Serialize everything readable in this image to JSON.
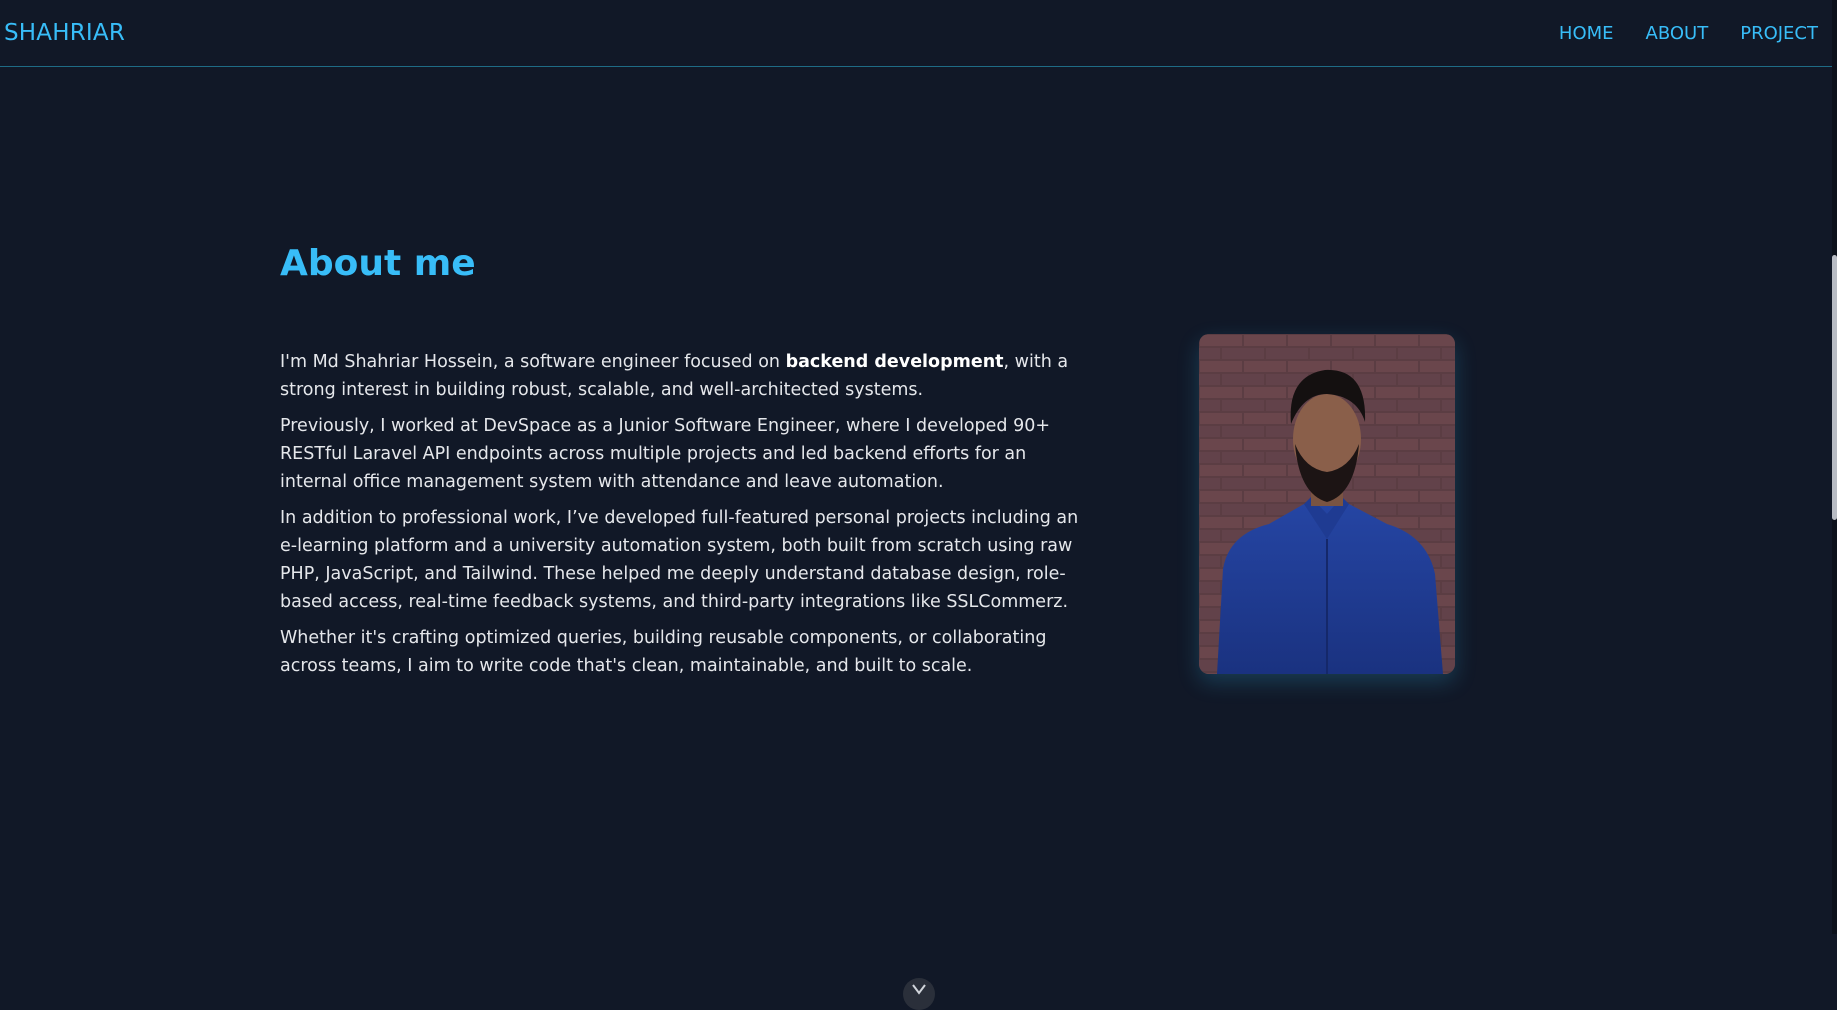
{
  "nav": {
    "brand": "SHAHRIAR",
    "links": [
      {
        "label": "HOME"
      },
      {
        "label": "ABOUT"
      },
      {
        "label": "PROJECT"
      }
    ]
  },
  "about": {
    "heading": "About me",
    "p1_before": "I'm Md Shahriar Hossein, a software engineer focused on ",
    "p1_bold": "backend development",
    "p1_after": ", with a strong interest in building robust, scalable, and well-architected systems.",
    "p2": "Previously, I worked at DevSpace as a Junior Software Engineer, where I developed 90+ RESTful Laravel API endpoints across multiple projects and led backend efforts for an internal office management system with attendance and leave automation.",
    "p3": "In addition to professional work, I’ve developed full-featured personal projects including an e-learning platform and a university automation system, both built from scratch using raw PHP, JavaScript, and Tailwind. These helped me deeply understand database design, role-based access, real-time feedback systems, and third-party integrations like SSLCommerz.",
    "p4": "Whether it's crafting optimized queries, building reusable components, or collaborating across teams, I aim to write code that's clean, maintainable, and built to scale."
  },
  "icons": {
    "scroll_down": "chevron-down-icon",
    "profile_photo": "profile-photo"
  },
  "colors": {
    "background": "#111827",
    "accent": "#38bdf8",
    "text": "#e5e7eb",
    "nav_border": "#1e6b85"
  }
}
